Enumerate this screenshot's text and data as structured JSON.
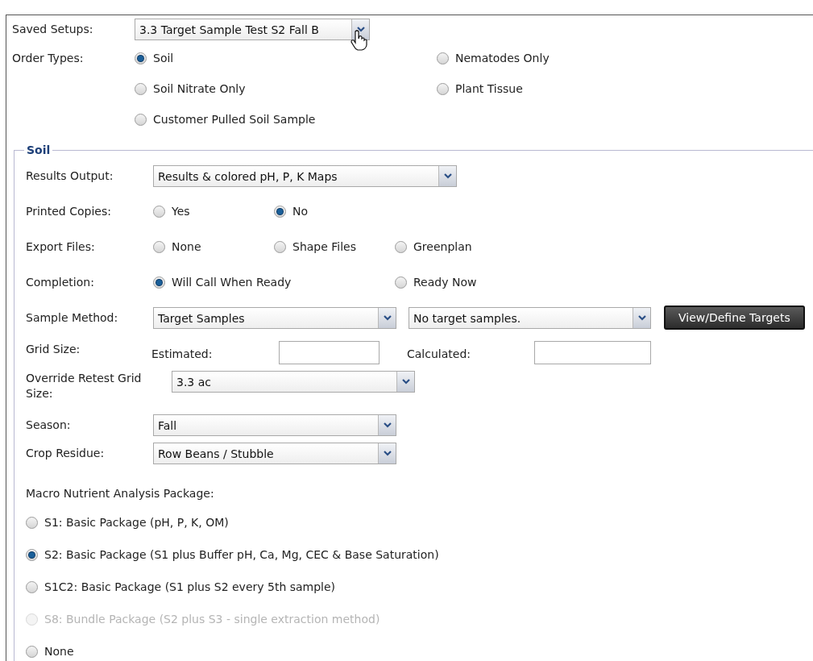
{
  "saved_setups": {
    "label": "Saved Setups:",
    "value": "3.3 Target Sample Test S2 Fall B"
  },
  "order_types": {
    "label": "Order Types:",
    "options": [
      {
        "label": "Soil",
        "selected": true
      },
      {
        "label": "Nematodes Only",
        "selected": false
      },
      {
        "label": "Soil Nitrate Only",
        "selected": false
      },
      {
        "label": "Plant Tissue",
        "selected": false
      },
      {
        "label": "Customer Pulled Soil Sample",
        "selected": false
      }
    ]
  },
  "soil": {
    "legend": "Soil",
    "rows": [
      {
        "kind": "select",
        "label": "Results Output:",
        "value": "Results & colored pH, P, K Maps"
      },
      {
        "kind": "radio",
        "label": "Printed Copies:",
        "options": [
          {
            "label": "Yes",
            "selected": false
          },
          {
            "label": "No",
            "selected": true
          }
        ]
      },
      {
        "kind": "radio",
        "label": "Export Files:",
        "options": [
          {
            "label": "None",
            "selected": false
          },
          {
            "label": "Shape Files",
            "selected": false
          },
          {
            "label": "Greenplan",
            "selected": false
          }
        ]
      },
      {
        "kind": "radio",
        "label": "Completion:",
        "options": [
          {
            "label": "Will Call When Ready",
            "selected": true
          },
          {
            "label": "Ready Now",
            "selected": false
          }
        ]
      },
      {
        "kind": "select_pair",
        "label": "Sample Method:",
        "value": "Target Samples",
        "second_value": "No target samples.",
        "button": "View/Define Targets"
      },
      {
        "kind": "inputs",
        "label": "Grid Size:",
        "fields": [
          {
            "label": "Estimated:"
          },
          {
            "label": "Calculated:"
          }
        ]
      },
      {
        "kind": "select",
        "label": "Override Retest Grid Size:",
        "value": "3.3 ac"
      },
      {
        "kind": "select",
        "label": "Season:",
        "value": "Fall"
      },
      {
        "kind": "select",
        "label": "Crop Residue:",
        "value": "Row Beans / Stubble"
      }
    ]
  },
  "macro": {
    "label": "Macro Nutrient Analysis Package:",
    "options": [
      {
        "label": "S1: Basic Package (pH, P, K, OM)",
        "selected": false,
        "disabled": false
      },
      {
        "label": "S2: Basic Package (S1 plus Buffer pH, Ca, Mg, CEC & Base Saturation)",
        "selected": true,
        "disabled": false
      },
      {
        "label": "S1C2: Basic Package (S1 plus S2 every 5th sample)",
        "selected": false,
        "disabled": false
      },
      {
        "label": "S8: Bundle Package (S2 plus S3 - single extraction method)",
        "selected": false,
        "disabled": true
      },
      {
        "label": "None",
        "selected": false,
        "disabled": false
      }
    ]
  }
}
